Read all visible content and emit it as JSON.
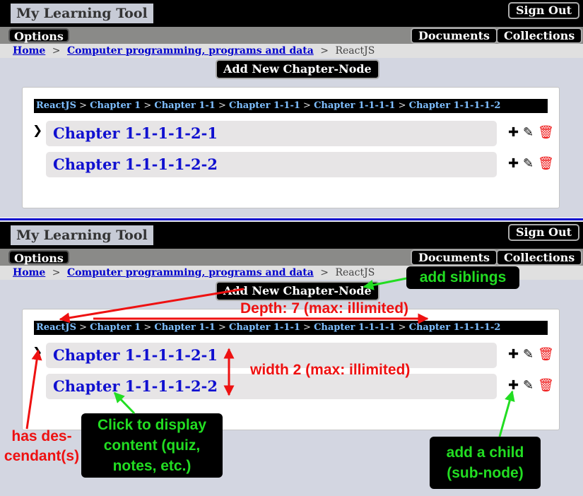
{
  "app": {
    "title": "My Learning Tool",
    "sign_out": "Sign Out"
  },
  "nav": {
    "options": "Options",
    "documents": "Documents",
    "collections": "Collections"
  },
  "breadcrumb": {
    "home": "Home",
    "sep": ">",
    "category": "Computer programming, programs and data",
    "current": "ReactJS"
  },
  "add_button": "Add New Chapter-Node",
  "path": [
    "ReactJS",
    "Chapter 1",
    "Chapter 1-1",
    "Chapter 1-1-1",
    "Chapter 1-1-1-1",
    "Chapter 1-1-1-1-2"
  ],
  "path_sep": ">",
  "nodes": [
    {
      "label": "Chapter 1-1-1-1-2-1",
      "has_descendants": true
    },
    {
      "label": "Chapter 1-1-1-1-2-2",
      "has_descendants": false
    }
  ],
  "icons": {
    "expand": "chevron-right-icon",
    "add": "plus-icon",
    "edit": "pencil-icon",
    "delete": "trash-icon"
  },
  "annotations": {
    "add_siblings": "add siblings",
    "depth": "Depth: 7 (max: illimited)",
    "width": "width 2 (max: illimited)",
    "has_descendants_1": "has des-",
    "has_descendants_2": "cendant(s)",
    "click_1": "Click to display",
    "click_2": "content (quiz,",
    "click_3": "notes, etc.)",
    "child_1": "add a child",
    "child_2": "(sub-node)"
  },
  "colors": {
    "annotation_red": "#ee1111",
    "annotation_green": "#22dd22",
    "link_blue": "#0000cc",
    "node_blue": "#1010d0",
    "delete_red": "#ee1111"
  }
}
